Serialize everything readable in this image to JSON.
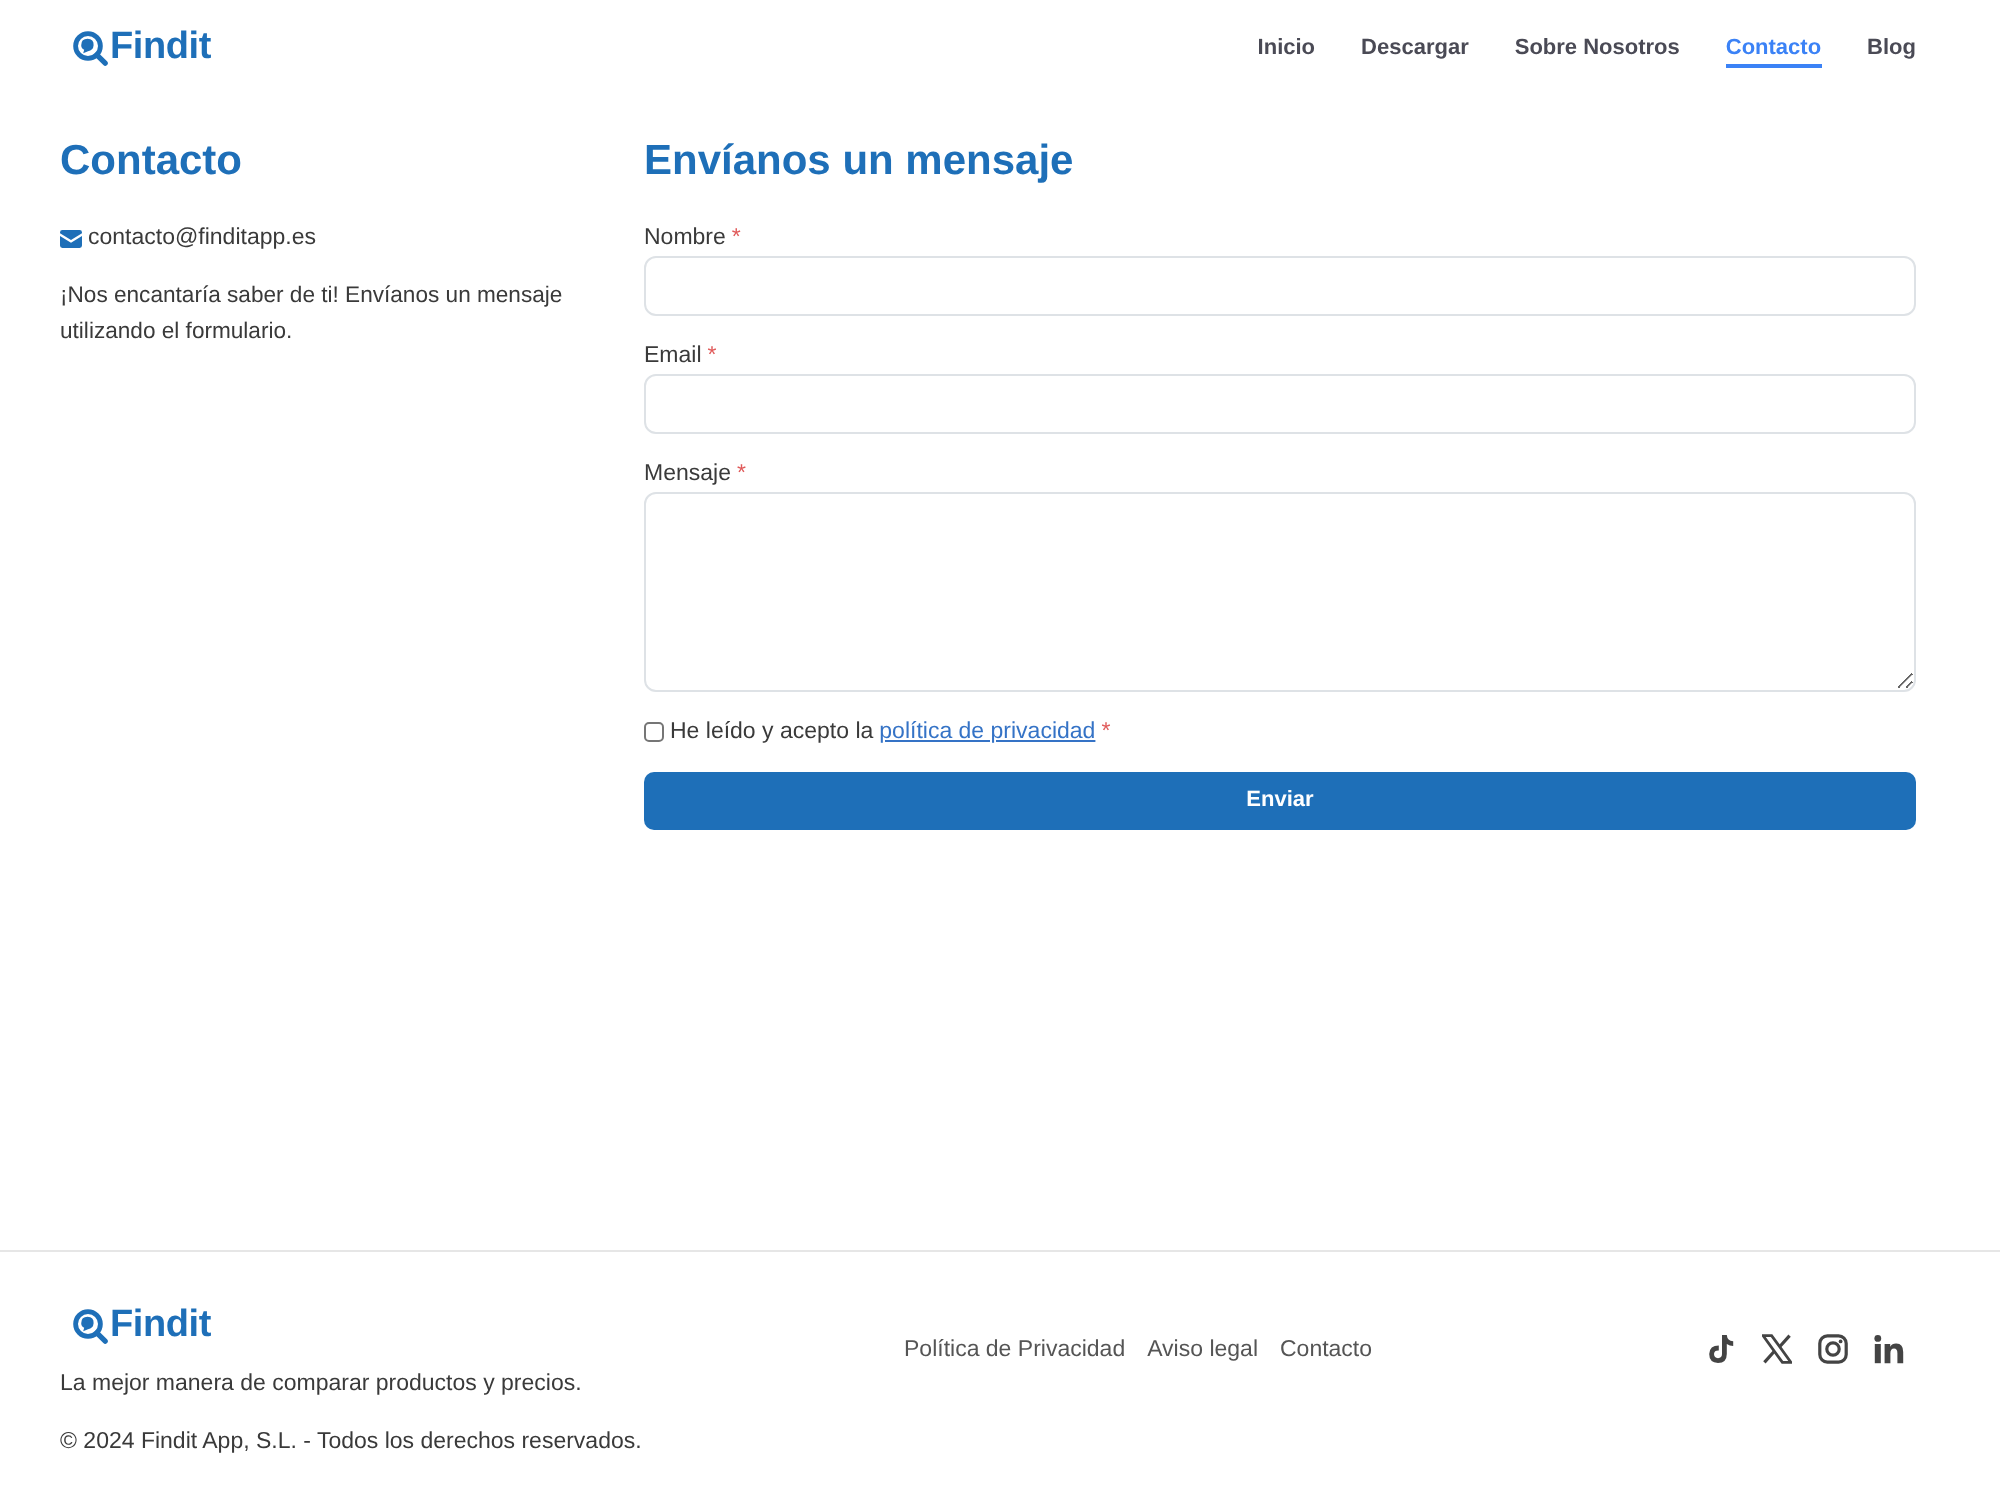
{
  "header": {
    "logo": "Findit",
    "nav": [
      {
        "label": "Inicio",
        "selected": false
      },
      {
        "label": "Descargar",
        "selected": false
      },
      {
        "label": "Sobre Nosotros",
        "selected": false
      },
      {
        "label": "Contacto",
        "selected": true
      },
      {
        "label": "Blog",
        "selected": false
      }
    ]
  },
  "contact": {
    "title": "Contacto",
    "email": "contacto@finditapp.es",
    "intro": "¡Nos encantaría saber de ti! Envíanos un mensaje utilizando el formulario."
  },
  "form": {
    "title": "Envíanos un mensaje",
    "fields": [
      {
        "kind": "text",
        "label": "Nombre",
        "required_mark": "*"
      },
      {
        "kind": "text",
        "label": "Email",
        "required_mark": "*"
      },
      {
        "kind": "textarea",
        "label": "Mensaje",
        "required_mark": "*"
      }
    ],
    "consent": {
      "checked": false,
      "text": "He leído y acepto la",
      "link": "política de privacidad",
      "required_mark": "*"
    },
    "submit": "Enviar"
  },
  "footer": {
    "logo": "Findit",
    "tagline": "La mejor manera de comparar productos y precios.",
    "copyright": "© 2024 Findit App, S.L. - Todos los derechos reservados.",
    "links": [
      "Política de Privacidad",
      "Aviso legal",
      "Contacto"
    ]
  }
}
